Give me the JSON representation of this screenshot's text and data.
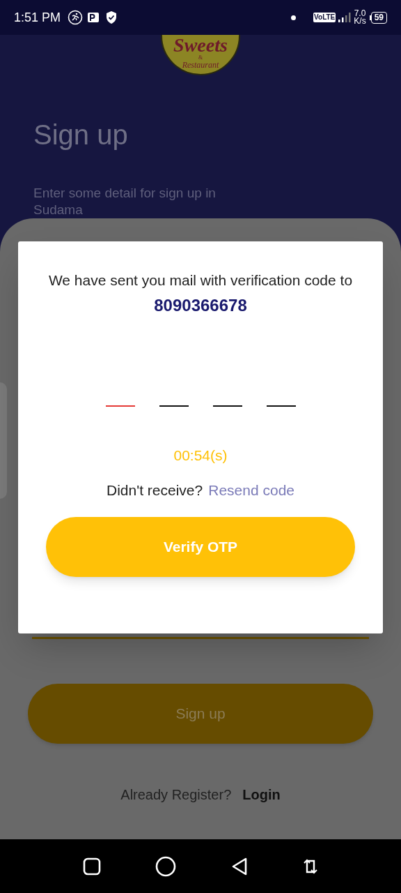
{
  "status_bar": {
    "time": "1:51 PM",
    "network_badge": "VoLTE",
    "speed_value": "7.0",
    "speed_unit": "K/s",
    "battery": "59"
  },
  "logo": {
    "name": "Sweets",
    "ampersand": "&",
    "subtitle": "Restaurant"
  },
  "header": {
    "title": "Sign up",
    "subtitle": "Enter some detail for sign up in Sudama"
  },
  "form": {
    "submit_button": "Sign up",
    "footer_prompt": "Already Register?",
    "footer_link": "Login"
  },
  "dialog": {
    "message": "We have sent you mail with verification code to",
    "phone": "8090366678",
    "otp_slots": [
      {
        "selected": true
      },
      {
        "selected": false
      },
      {
        "selected": false
      },
      {
        "selected": false
      }
    ],
    "timer": "00:54(s)",
    "resend_prompt": "Didn't receive?",
    "resend_link": "Resend code",
    "verify_button": "Verify OTP"
  }
}
